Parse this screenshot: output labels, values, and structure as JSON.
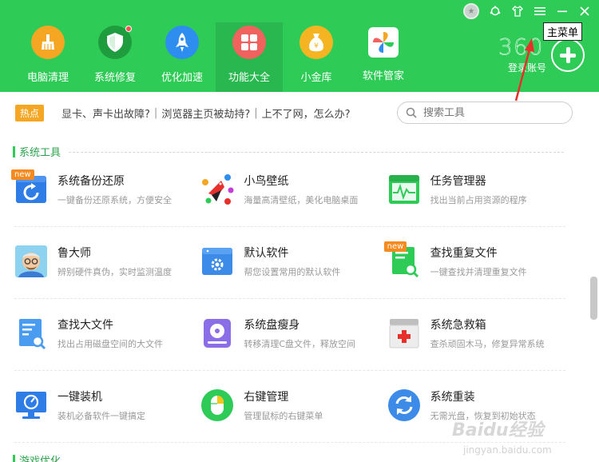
{
  "window": {
    "controls": [
      "medal",
      "skin",
      "shirt",
      "menu",
      "minimize",
      "close"
    ]
  },
  "nav": {
    "items": [
      {
        "label": "电脑清理",
        "icon": "broom-icon",
        "color": "#f5a623"
      },
      {
        "label": "系统修复",
        "icon": "shield-icon",
        "color": "#1f9c3e"
      },
      {
        "label": "优化加速",
        "icon": "rocket-icon",
        "color": "#2e8ef0"
      },
      {
        "label": "功能大全",
        "icon": "grid-apps-icon",
        "color": "#f0625e"
      },
      {
        "label": "小金库",
        "icon": "money-bag-icon",
        "color": "#f5b522"
      },
      {
        "label": "软件管家",
        "icon": "software-icon",
        "color": "#ffffff"
      }
    ]
  },
  "brand": {
    "logo": "360",
    "login": "登录账号"
  },
  "tooltip": {
    "text": "主菜单"
  },
  "hotbar": {
    "badge": "热点",
    "links": [
      "显卡、声卡出故障?",
      "浏览器主页被劫持?",
      "上不了网，怎么办?"
    ]
  },
  "search": {
    "placeholder": "搜索工具"
  },
  "section": {
    "title": "系统工具",
    "next_title": "游戏优化"
  },
  "tools": [
    {
      "name": "系统备份还原",
      "desc": "一键备份还原系统，方便安全",
      "new": "new"
    },
    {
      "name": "小鸟壁纸",
      "desc": "海量高清壁纸，美化电脑桌面"
    },
    {
      "name": "任务管理器",
      "desc": "找出当前占用资源的程序"
    },
    {
      "name": "鲁大师",
      "desc": "辨别硬件真伪，实时监测温度"
    },
    {
      "name": "默认软件",
      "desc": "帮您设置常用的默认软件"
    },
    {
      "name": "查找重复文件",
      "desc": "一键查找并清理重复文件",
      "new": "new"
    },
    {
      "name": "查找大文件",
      "desc": "找出占用磁盘空间的大文件"
    },
    {
      "name": "系统盘瘦身",
      "desc": "转移清理C盘文件，释放空间"
    },
    {
      "name": "系统急救箱",
      "desc": "查杀顽固木马，修复异常系统"
    },
    {
      "name": "一键装机",
      "desc": "装机必备软件一键搞定"
    },
    {
      "name": "右键管理",
      "desc": "管理鼠标的右键菜单"
    },
    {
      "name": "系统重装",
      "desc": "无需光盘，恢复到初始状态"
    }
  ],
  "watermark": {
    "main": "Baidu经验",
    "sub": "jingyan.baidu.com"
  },
  "colors": {
    "header": "#2ecc57",
    "accent": "#2ca24d",
    "hot": "#f5a623",
    "new": "#f58a1f"
  }
}
